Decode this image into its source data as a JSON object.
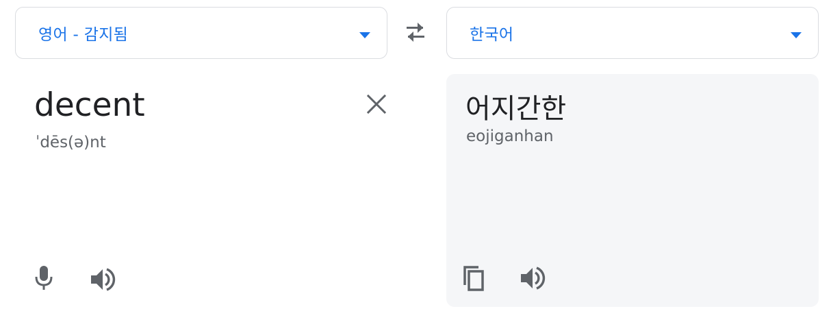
{
  "source_language": {
    "label": "영어 - 감지됨",
    "arrow_icon": "triangle-down-icon"
  },
  "target_language": {
    "label": "한국어",
    "arrow_icon": "triangle-down-icon"
  },
  "swap_icon": "swap-arrows-icon",
  "source": {
    "text": "decent",
    "phonetic": "ˈdēs(ə)nt",
    "clear_icon": "close-icon",
    "mic_icon": "microphone-icon",
    "speaker_icon": "speaker-icon"
  },
  "translation": {
    "text": "어지간한",
    "romanization": "eojiganhan",
    "copy_icon": "copy-icon",
    "speaker_icon": "speaker-icon"
  },
  "colors": {
    "accent": "#1a73e8",
    "icon_gray": "#5f6368",
    "panel_bg": "#f5f6f8",
    "border": "#dadce0"
  }
}
